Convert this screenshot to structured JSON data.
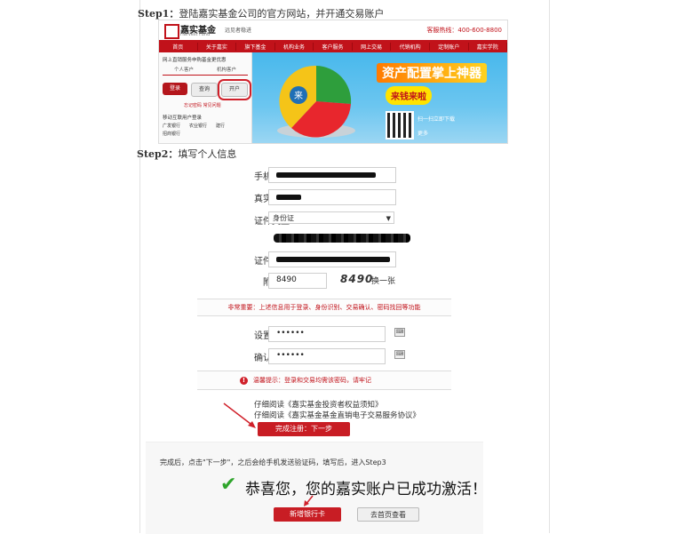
{
  "step1": {
    "label": "Step1：",
    "text": "登陆嘉实基金公司的官方网站，并开通交易账户"
  },
  "website": {
    "logo": "嘉实基金",
    "logo_sub": "Harvest Fund",
    "slogan": "远见者稳进",
    "hotline": "客服热线：400-600-8800",
    "nav": [
      "首页",
      "关于嘉实",
      "旗下基金",
      "机构业务",
      "客户服务",
      "网上交易",
      "代销机构",
      "定制账户",
      "嘉实学院"
    ],
    "login_title": "网上直销服务申购基金更优惠",
    "tabs": [
      "个人客户",
      "机构客户"
    ],
    "login_button": "登录",
    "query_button": "查询",
    "open_button": "开户",
    "links": "忘记密码  常见问题",
    "mobile_login": "移动互联用户登录",
    "mobile_items": [
      "广发银行",
      "农业银行",
      "建行",
      "招商银行"
    ],
    "banner_title": "资产配置掌上神器",
    "banner_sub": "来钱来啦",
    "banner_download": "扫一扫立即下载",
    "banner_more": "更多"
  },
  "step2": {
    "label": "Step2：",
    "text": "填写个人信息"
  },
  "form": {
    "phone_label": "手机号码：",
    "name_label": "真实姓名：",
    "id_type_label": "证件类型：",
    "id_type_value": "身份证",
    "id_no_label": "证件号码：",
    "captcha_label": "附加码：",
    "captcha_value": "8490",
    "captcha_image": "8490",
    "captcha_refresh": "换一张",
    "important_notice": "非常重要：上述信息用于登录、身份识别、交易确认、密码找回等功能",
    "set_password_label": "设置密码：",
    "set_password_value": "••••••",
    "confirm_password_label": "确认密码：",
    "confirm_password_value": "••••••",
    "warm_tip": "温馨提示：登录和交易均需该密码，请牢记",
    "agreement1": "仔细阅读《嘉实基金投资者权益须知》",
    "agreement2": "仔细阅读《嘉实基金基金直销电子交易服务协议》",
    "submit": "完成注册：下一步"
  },
  "step3_section": {
    "instruction": "完成后，点击\"下一步\"，之后会给手机发送验证码，填写后，进入Step3",
    "success": "恭喜您，您的嘉实账户已成功激活！",
    "add_card": "新增银行卡",
    "go_home": "去首页查看"
  },
  "colors": {
    "brand_red": "#c81d24",
    "success_green": "#2fa52c",
    "banner_blue": "#48b8ec"
  }
}
